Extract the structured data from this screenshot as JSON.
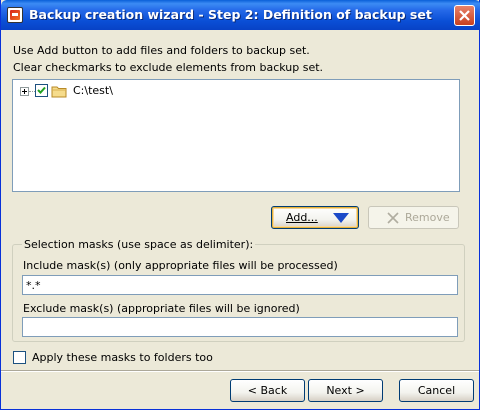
{
  "window": {
    "title": "Backup creation wizard - Step 2: Definition of backup set"
  },
  "instructions": {
    "line1": "Use Add button to add files and folders to backup set.",
    "line2": "Clear checkmarks to exclude elements from backup set."
  },
  "tree": {
    "items": [
      {
        "label": "C:\\test\\",
        "checked": true,
        "expanded": false,
        "icon": "folder-icon"
      }
    ]
  },
  "buttons": {
    "add": "Add...",
    "remove": "Remove",
    "back": "< Back",
    "next": "Next >",
    "cancel": "Cancel"
  },
  "masks": {
    "group_label": "Selection masks (use space as delimiter):",
    "include_label": "Include mask(s) (only appropriate files will be processed)",
    "include_value": "*.*",
    "exclude_label": "Exclude mask(s) (appropriate files will be ignored)",
    "exclude_value": "",
    "apply_to_folders_label": "Apply these masks to folders too",
    "apply_to_folders_checked": false
  },
  "colors": {
    "titlebar": "#0a4fd6",
    "dropdown_arrow": "#1c4ac8",
    "window_bg": "#ece9d8"
  }
}
